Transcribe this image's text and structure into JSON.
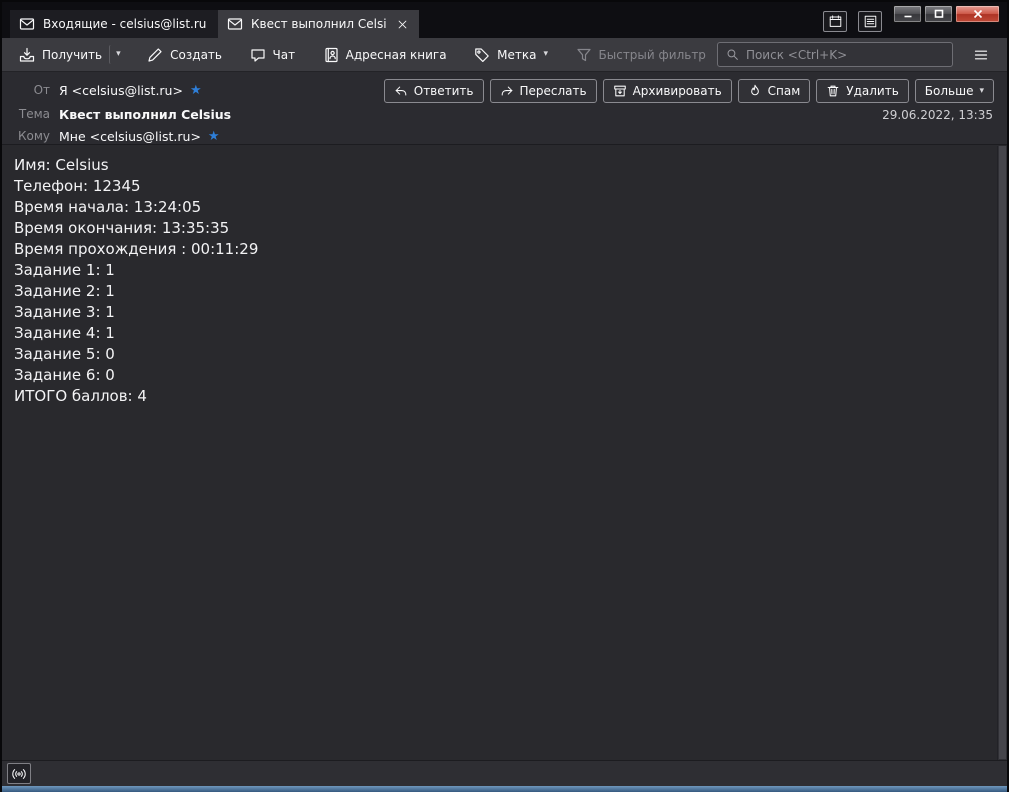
{
  "titlebar": {
    "tabs": [
      {
        "label": "Входящие - celsius@list.ru"
      },
      {
        "label": "Квест выполнил Celsius - В"
      }
    ]
  },
  "toolbar": {
    "get_messages": "Получить",
    "write": "Создать",
    "chat": "Чат",
    "address_book": "Адресная книга",
    "tag": "Метка",
    "quick_filter": "Быстрый фильтр",
    "search_placeholder": "Поиск <Ctrl+K>"
  },
  "header": {
    "from_label": "От",
    "from_value": "Я <celsius@list.ru>",
    "subject_label": "Тема",
    "subject_value": "Квест выполнил Celsius",
    "to_label": "Кому",
    "to_value": "Мне <celsius@list.ru>",
    "date": "29.06.2022, 13:35",
    "star": "★",
    "buttons": {
      "reply": "Ответить",
      "forward": "Переслать",
      "archive": "Архивировать",
      "junk": "Спам",
      "delete": "Удалить",
      "more": "Больше"
    }
  },
  "body": {
    "lines": [
      "Имя: Celsius",
      "Телефон: 12345",
      "Время начала: 13:24:05",
      "Время окончания: 13:35:35",
      "Время прохождения : 00:11:29",
      "Задание 1: 1",
      "Задание 2: 1",
      "Задание 3: 1",
      "Задание 4: 1",
      "Задание 5: 0",
      "Задание 6: 0",
      "ИТОГО баллов: 4"
    ]
  },
  "icons": {
    "caret": "▾"
  },
  "colors": {
    "star_accent": "#2e7fd9",
    "close_button_red": "#c14b38",
    "bottom_edge_blue": "#35597f",
    "background_dark": "#29292d"
  }
}
